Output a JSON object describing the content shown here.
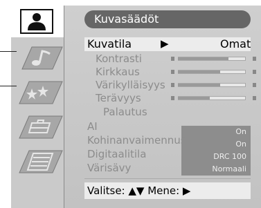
{
  "menu": {
    "title": "Kuvasäädöt",
    "selected": {
      "label": "Kuvatila",
      "arrow": "▶",
      "value": "Omat"
    },
    "sliders": [
      {
        "label": "Kontrasti",
        "level": 0.74
      },
      {
        "label": "Kirkkaus",
        "level": 0.62
      },
      {
        "label": "Värikylläisyys",
        "level": 0.62
      },
      {
        "label": "Terävyys",
        "level": 0.47
      }
    ],
    "reset": "Palautus",
    "options": [
      {
        "label": "AI",
        "value": "On"
      },
      {
        "label": "Kohinanvaimennus",
        "value": "On"
      },
      {
        "label": "Digitaalitila",
        "value": "DRC 100"
      },
      {
        "label": "Värisävy",
        "value": "Normaali"
      }
    ],
    "footer": "Valitse: ▲▼ Mene: ▶"
  },
  "tabs": [
    {
      "name": "person-icon",
      "active": true
    },
    {
      "name": "music-note-icon",
      "active": false
    },
    {
      "name": "star-icon",
      "active": false
    },
    {
      "name": "briefcase-icon",
      "active": false
    },
    {
      "name": "document-icon",
      "active": false
    }
  ]
}
